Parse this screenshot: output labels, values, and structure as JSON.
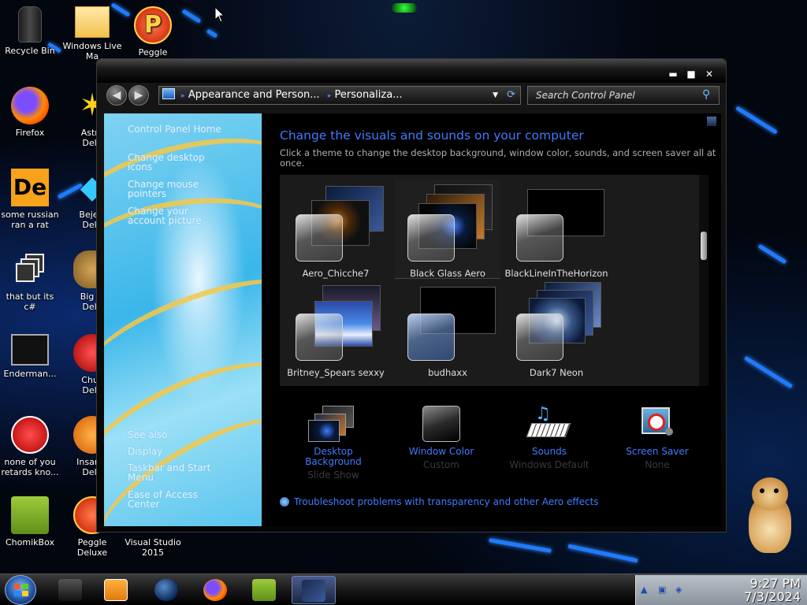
{
  "desktop": {
    "icons": [
      {
        "label": "Recycle Bin",
        "icon": "recycle-bin-icon"
      },
      {
        "label": "Windows Live\nMa",
        "icon": "windows-live-mail-icon"
      },
      {
        "label": "Peggle",
        "icon": "peggle-icon"
      },
      {
        "label": "Firefox",
        "icon": "firefox-icon"
      },
      {
        "label": "Astro\nDelu",
        "icon": "astro-icon"
      },
      {
        "label": "some russian\nran a rat",
        "icon": "de-icon"
      },
      {
        "label": "Bejew\nDelu",
        "icon": "bejeweled-icon"
      },
      {
        "label": "that but its\nc#",
        "icon": "windows-stack-icon"
      },
      {
        "label": "Big M\nDelu",
        "icon": "big-money-icon"
      },
      {
        "label": "Enderman...",
        "icon": "enderman-icon"
      },
      {
        "label": "Chuz\nDelu",
        "icon": "chuzzle-icon"
      },
      {
        "label": "none of you\nretards kno...",
        "icon": "rat-icon"
      },
      {
        "label": "Insaniq\nDelu",
        "icon": "insaniquarium-icon"
      },
      {
        "label": "ChomikBox",
        "icon": "chomikbox-icon"
      },
      {
        "label": "Peggle\nDeluxe",
        "icon": "peggle-deluxe-icon"
      },
      {
        "label": "Visual Studio\n2015",
        "icon": "visual-studio-icon"
      }
    ]
  },
  "window": {
    "controls": {
      "minimize": "▬",
      "maximize": "■",
      "close": "✕"
    },
    "nav": {
      "back": "◀",
      "forward": "▶"
    },
    "address": {
      "crumb1": "Appearance and Person...",
      "crumb2": "Personaliza..."
    },
    "search": {
      "placeholder": "Search Control Panel"
    },
    "sidebar": {
      "links": [
        "Control Panel Home",
        "Change desktop\nicons",
        "Change mouse\npointers",
        "Change your\naccount picture"
      ],
      "see_also": [
        "See also",
        "Display",
        "Taskbar and Start\nMenu",
        "Ease of Access\nCenter"
      ]
    },
    "content": {
      "heading": "Change the visuals and sounds on your computer",
      "subtext": "Click a theme to change the desktop background, window color, sounds, and screen saver all at once.",
      "themes": [
        {
          "name": "Aero_Chicche7",
          "selected": false
        },
        {
          "name": "Black Glass Aero",
          "selected": true
        },
        {
          "name": "BlackLineInTheHorizon",
          "selected": false
        },
        {
          "name": "Britney_Spears sexxy",
          "selected": false
        },
        {
          "name": "budhaxx",
          "selected": false
        },
        {
          "name": "Dark7 Neon",
          "selected": false
        }
      ],
      "customize": [
        {
          "title": "Desktop\nBackground",
          "value": "Slide Show",
          "icon": "desktop-background-icon"
        },
        {
          "title": "Window Color",
          "value": "Custom",
          "icon": "window-color-icon"
        },
        {
          "title": "Sounds",
          "value": "Windows Default",
          "icon": "sounds-icon"
        },
        {
          "title": "Screen Saver",
          "value": "None",
          "icon": "screen-saver-icon"
        }
      ],
      "troubleshoot": "Troubleshoot problems with transparency and other Aero effects"
    }
  },
  "taskbar": {
    "items": [
      "explorer-icon",
      "media-player-icon",
      "globe-icon",
      "firefox-icon",
      "chomikbox-icon",
      "personalization-window-icon"
    ],
    "clock": {
      "time": "9:27 PM",
      "date": "7/3/2024"
    }
  },
  "colors": {
    "accent": "#3f7cff",
    "link_dim": "#3a3a3a",
    "stripe": "#1e7bff"
  }
}
